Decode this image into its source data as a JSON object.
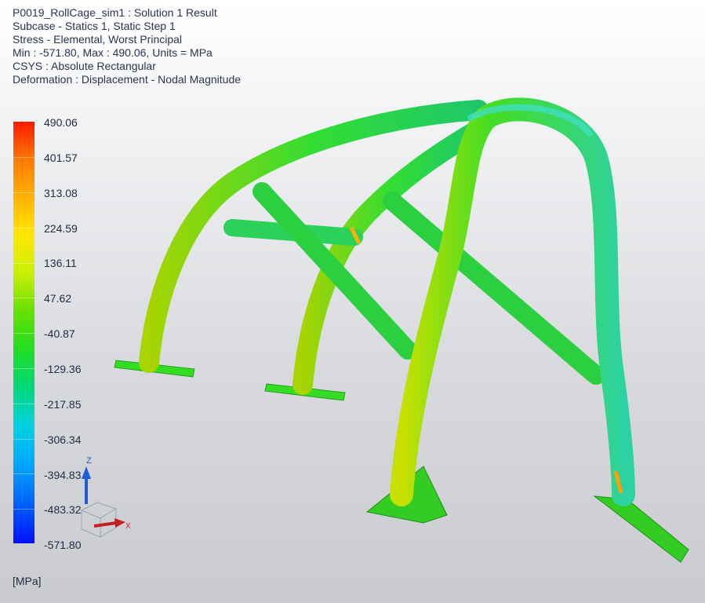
{
  "header": {
    "line1": "P0019_RollCage_sim1 : Solution 1 Result",
    "line2": "Subcase - Statics 1, Static Step 1",
    "line3": "Stress - Elemental, Worst Principal",
    "line4": "Min : -571.80, Max : 490.06, Units = MPa",
    "line5": "CSYS : Absolute Rectangular",
    "line6": "Deformation : Displacement - Nodal Magnitude"
  },
  "legend": {
    "labels": [
      "490.06",
      "401.57",
      "313.08",
      "224.59",
      "136.11",
      "47.62",
      "-40.87",
      "-129.36",
      "-217.85",
      "-306.34",
      "-394.83",
      "-483.32",
      "-571.80"
    ],
    "units": "[MPa]"
  },
  "triad": {
    "z_label": "Z",
    "x_label": "X"
  },
  "colors": {
    "max": "#ff1a00",
    "min": "#0010ff",
    "structure": "#22cc22"
  }
}
